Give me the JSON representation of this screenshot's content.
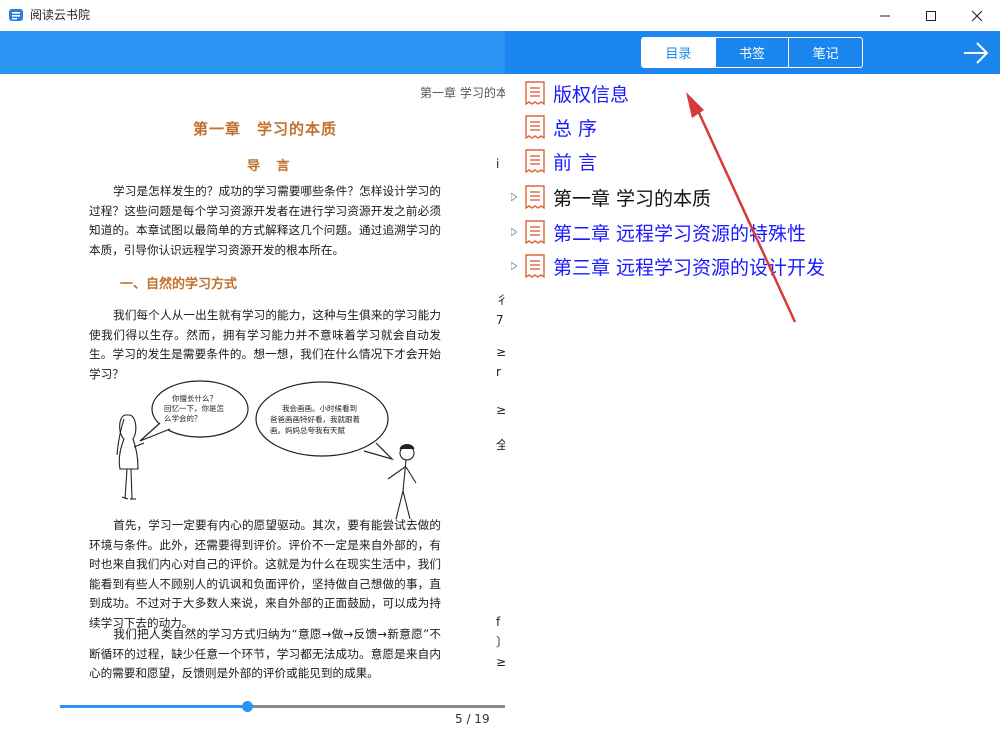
{
  "window": {
    "title": "阅读云书院",
    "controls": {
      "minimize": "minimize-icon",
      "maximize": "maximize-icon",
      "close": "close-icon"
    }
  },
  "reader": {
    "running_head": "第一章  学习的本",
    "chapter_title": "第一章　学习的本质",
    "intro_title": "导 言",
    "intro_paragraph": "学习是怎样发生的？成功的学习需要哪些条件？怎样设计学习的过程？这些问题是每个学习资源开发者在进行学习资源开发之前必须知道的。本章试图以最简单的方式解释这几个问题。通过追溯学习的本质，引导你认识远程学习资源开发的根本所在。",
    "section_title": "一、自然的学习方式",
    "paragraph_2": "我们每个人从一出生就有学习的能力，这种与生俱来的学习能力使我们得以生存。然而，拥有学习能力并不意味着学习就会自动发生。学习的发生是需要条件的。想一想，我们在什么情况下才会开始学习？",
    "bubble_left": [
      "你擅长什么？",
      "回忆一下，你是怎",
      "么学会的？"
    ],
    "bubble_right": [
      "我会画画。小时候看到",
      "爸爸画画特好看，我就跟着",
      "画。妈妈总夸我有天赋"
    ],
    "paragraph_3": "首先，学习一定要有内心的愿望驱动。其次，要有能尝试去做的环境与条件。此外，还需要得到评价。评价不一定是来自外部的，有时也来自我们内心对自己的评价。这就是为什么在现实生活中，我们能看到有些人不顾别人的讥讽和负面评价，坚持做自己想做的事，直到成功。不过对于大多数人来说，来自外部的正面鼓励，可以成为持续学习下去的动力。",
    "paragraph_4": "我们把人类自然的学习方式归纳为“意愿→做→反馈→新意愿”不断循环的过程，缺少任意一个环节，学习都无法成功。意愿是来自内心的需要和愿望，反馈则是外部的评价或能见到的成果。",
    "right_edge_chars": [
      "i",
      "",
      "",
      "",
      "",
      "",
      "",
      "",
      "",
      "",
      "彳",
      "",
      "",
      "",
      "",
      "",
      "",
      "",
      "",
      "",
      "",
      "",
      "",
      "",
      "",
      "",
      "",
      "",
      "",
      "",
      "",
      "",
      "",
      "",
      "",
      "",
      "",
      "",
      "",
      "",
      "",
      "",
      "",
      "",
      "",
      "",
      "",
      "",
      "",
      "",
      "",
      "",
      "",
      "",
      "",
      "",
      "",
      "",
      "",
      "",
      "",
      "",
      "",
      "",
      "",
      "",
      "",
      "",
      "",
      "",
      "",
      "",
      "",
      "",
      "",
      "",
      "",
      "",
      "",
      "",
      "",
      "",
      "",
      "",
      "",
      "",
      "",
      "",
      "",
      "",
      "",
      "",
      "",
      "",
      "",
      "",
      "",
      "",
      "",
      "",
      "",
      "",
      "",
      "",
      "",
      "",
      "",
      "",
      "",
      "",
      "",
      "",
      "",
      "",
      "",
      "",
      "",
      "",
      "",
      "",
      "",
      "",
      "",
      ""
    ],
    "progress": {
      "current_page": 5,
      "total_pages": 19,
      "label": "5 / 19",
      "fraction": 0.42
    }
  },
  "toc_panel": {
    "tabs": [
      {
        "label": "目录",
        "active": true
      },
      {
        "label": "书签",
        "active": false
      },
      {
        "label": "笔记",
        "active": false
      }
    ],
    "forward_icon": "arrow-right-icon",
    "items": [
      {
        "label": "版权信息",
        "color": "blue",
        "expandable": false
      },
      {
        "label": "总 序",
        "color": "blue",
        "expandable": false
      },
      {
        "label": "前 言",
        "color": "blue",
        "expandable": false
      },
      {
        "label": "第一章 学习的本质",
        "color": "dark",
        "expandable": true
      },
      {
        "label": "第二章 远程学习资源的特殊性",
        "color": "blue",
        "expandable": true
      },
      {
        "label": "第三章 远程学习资源的设计开发",
        "color": "blue",
        "expandable": true
      }
    ]
  },
  "colors": {
    "header_left": "#2b95f4",
    "header_right": "#1a86ee",
    "toc_link": "#1a1aff",
    "chapter_heading": "#c0712f",
    "doc_icon": "#e0643a",
    "annotation_arrow": "#d63a3a"
  }
}
